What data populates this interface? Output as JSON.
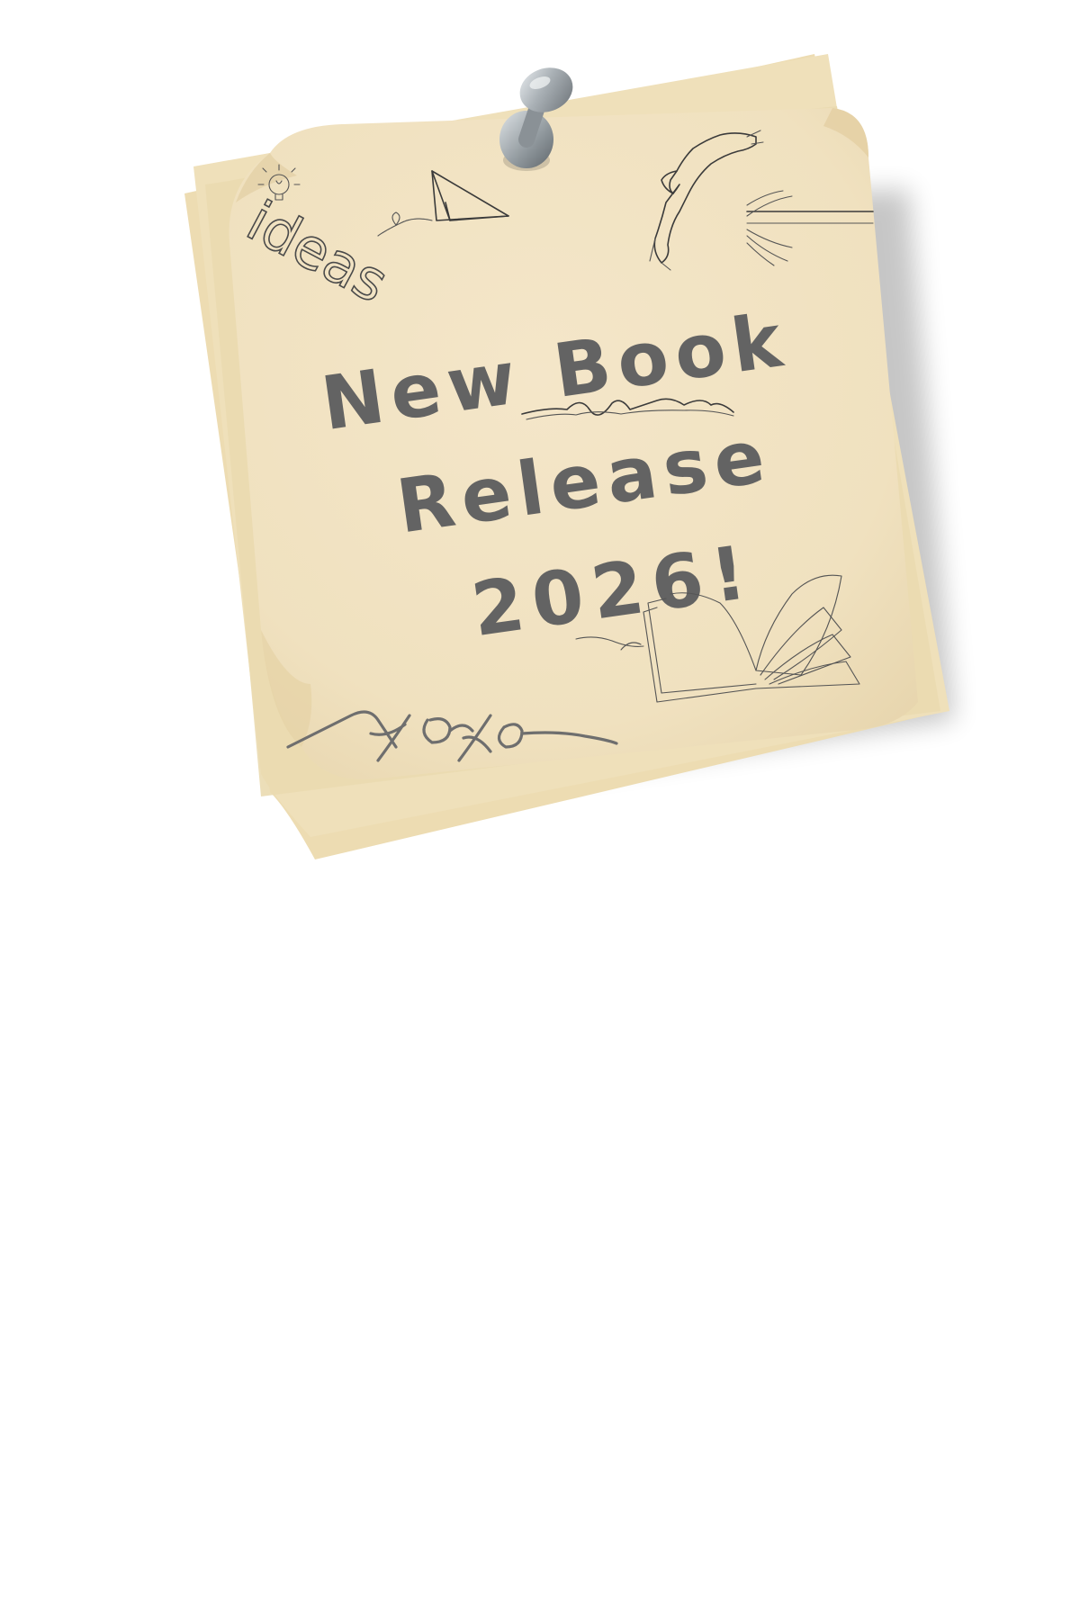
{
  "note": {
    "title_line1": "New Book",
    "title_line2": "Release",
    "title_line3": "2026!",
    "doodle_word": "ideas",
    "signature": "xoxo"
  },
  "colors": {
    "paper": "#f2e4c6",
    "paper_back": "#ecdcb4",
    "ink": "#636363",
    "pin": "#9aa1a6"
  },
  "icons": {
    "pin": "pushpin-icon",
    "bulb": "lightbulb-icon",
    "plane": "paper-airplane-icon",
    "figure": "diving-figure-icon",
    "book": "open-book-icon"
  }
}
